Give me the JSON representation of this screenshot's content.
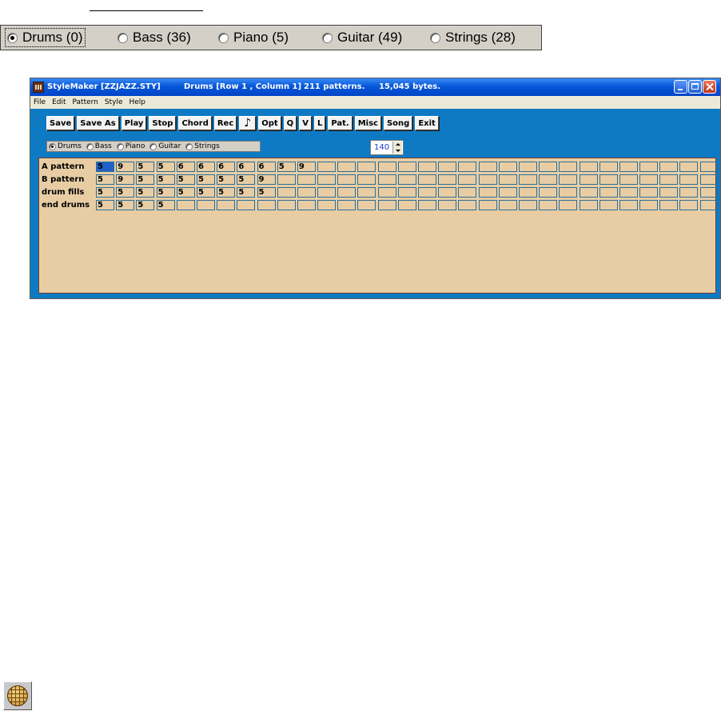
{
  "big_radio": {
    "options": [
      {
        "label": "Drums (0)",
        "selected": true
      },
      {
        "label": "Bass (36)",
        "selected": false
      },
      {
        "label": "Piano (5)",
        "selected": false
      },
      {
        "label": "Guitar (49)",
        "selected": false
      },
      {
        "label": "Strings (28)",
        "selected": false
      }
    ]
  },
  "window": {
    "title": "StyleMaker [ZZJAZZ.STY]",
    "status": "Drums  [Row 1 , Column 1]",
    "patterns": "211 patterns.",
    "bytes": "15,045 bytes.",
    "menu": [
      "File",
      "Edit",
      "Pattern",
      "Style",
      "Help"
    ],
    "toolbar": [
      "Save",
      "Save As",
      "Play",
      "Stop",
      "Chord",
      "Rec",
      "♪",
      "Opt",
      "Q",
      "V",
      "L",
      "Pat.",
      "Misc",
      "Song",
      "Exit"
    ],
    "small_radio": [
      {
        "label": "Drums",
        "selected": true
      },
      {
        "label": "Bass",
        "selected": false
      },
      {
        "label": "Piano",
        "selected": false
      },
      {
        "label": "Guitar",
        "selected": false
      },
      {
        "label": "Strings",
        "selected": false
      }
    ],
    "tempo": "140",
    "grid": {
      "columns": 31,
      "rows": [
        {
          "label": "A pattern",
          "cells": [
            "5",
            "9",
            "5",
            "5",
            "6",
            "6",
            "6",
            "6",
            "6",
            "5",
            "9"
          ]
        },
        {
          "label": "B pattern",
          "cells": [
            "5",
            "9",
            "5",
            "5",
            "5",
            "5",
            "5",
            "5",
            "9"
          ]
        },
        {
          "label": "drum fills",
          "cells": [
            "5",
            "5",
            "5",
            "5",
            "5",
            "5",
            "5",
            "5",
            "5"
          ]
        },
        {
          "label": "end drums",
          "cells": [
            "5",
            "5",
            "5",
            "5"
          ]
        }
      ],
      "selected_cell": {
        "row": 1,
        "column": 1
      }
    }
  },
  "colors": {
    "window_bg": "#0f7ac4",
    "grid_bg": "#e8cda4",
    "title_blue": "#0757d8",
    "selected_cell": "#1f63c8"
  },
  "icons": [
    "app-icon",
    "minimize-icon",
    "maximize-icon",
    "close-icon",
    "globe-icon"
  ]
}
